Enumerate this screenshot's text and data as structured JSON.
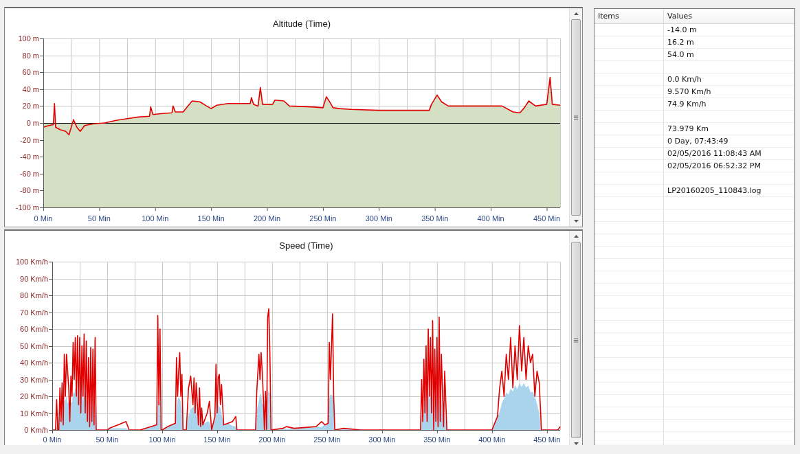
{
  "charts": [
    {
      "chart_data": {
        "type": "area",
        "title": "Altitude (Time)",
        "grid": true,
        "xlim": [
          0,
          462
        ],
        "ylim": [
          -100,
          100
        ],
        "xticks": [
          {
            "value": 0,
            "label": "0 Min"
          },
          {
            "value": 50,
            "label": "50 Min"
          },
          {
            "value": 100,
            "label": "100 Min"
          },
          {
            "value": 150,
            "label": "150 Min"
          },
          {
            "value": 200,
            "label": "200 Min"
          },
          {
            "value": 250,
            "label": "250 Min"
          },
          {
            "value": 300,
            "label": "300 Min"
          },
          {
            "value": 350,
            "label": "350 Min"
          },
          {
            "value": 400,
            "label": "400 Min"
          },
          {
            "value": 450,
            "label": "450 Min"
          }
        ],
        "yticks": [
          {
            "value": 100,
            "label": "100 m"
          },
          {
            "value": 80,
            "label": "80 m"
          },
          {
            "value": 60,
            "label": "60 m"
          },
          {
            "value": 40,
            "label": "40 m"
          },
          {
            "value": 20,
            "label": "20 m"
          },
          {
            "value": 0,
            "label": "0 m"
          },
          {
            "value": -20,
            "label": "-20 m"
          },
          {
            "value": -40,
            "label": "-40 m"
          },
          {
            "value": -60,
            "label": "-60 m"
          },
          {
            "value": -80,
            "label": "-80 m"
          },
          {
            "value": -100,
            "label": "-100 m"
          }
        ],
        "x": [
          0,
          5,
          9,
          10,
          11,
          15,
          20,
          23,
          25,
          27,
          30,
          33,
          37,
          45,
          55,
          65,
          75,
          85,
          95,
          96,
          98,
          105,
          115,
          116,
          118,
          125,
          128,
          133,
          140,
          146,
          150,
          155,
          165,
          185,
          186,
          188,
          192,
          194,
          196,
          205,
          207,
          215,
          220,
          240,
          250,
          253,
          256,
          259,
          265,
          275,
          300,
          330,
          345,
          347,
          352,
          356,
          362,
          375,
          400,
          410,
          420,
          426,
          430,
          434,
          440,
          450,
          453,
          455,
          462
        ],
        "series": [
          {
            "color": "#e00000",
            "values": [
              -5,
              -3,
              -2,
              23,
              -5,
              -8,
              -10,
              -14,
              -5,
              4,
              -5,
              -10,
              -3,
              -1,
              0,
              3,
              5,
              7,
              8,
              19,
              10,
              11,
              12,
              20,
              13,
              13,
              18,
              26,
              25,
              20,
              17,
              21,
              23,
              23,
              30,
              22,
              20,
              42,
              22,
              22,
              27,
              26,
              20,
              19,
              18,
              31,
              25,
              18,
              17,
              16,
              15,
              15,
              15,
              22,
              33,
              25,
              20,
              20,
              20,
              20,
              13,
              12,
              18,
              26,
              20,
              22,
              54,
              22,
              21
            ]
          }
        ]
      }
    },
    {
      "chart_data": {
        "type": "line",
        "title": "Speed (Time)",
        "grid": true,
        "xlim": [
          0,
          462
        ],
        "ylim": [
          0,
          100
        ],
        "xticks": [
          {
            "value": 0,
            "label": "0 Min"
          },
          {
            "value": 50,
            "label": "50 Min"
          },
          {
            "value": 100,
            "label": "100 Min"
          },
          {
            "value": 150,
            "label": "150 Min"
          },
          {
            "value": 200,
            "label": "200 Min"
          },
          {
            "value": 250,
            "label": "250 Min"
          },
          {
            "value": 300,
            "label": "300 Min"
          },
          {
            "value": 350,
            "label": "350 Min"
          },
          {
            "value": 400,
            "label": "400 Min"
          },
          {
            "value": 450,
            "label": "450 Min"
          }
        ],
        "yticks": [
          {
            "value": 100,
            "label": "100 Km/h"
          },
          {
            "value": 90,
            "label": "90 Km/h"
          },
          {
            "value": 80,
            "label": "80 Km/h"
          },
          {
            "value": 70,
            "label": "70 Km/h"
          },
          {
            "value": 60,
            "label": "60 Km/h"
          },
          {
            "value": 50,
            "label": "50 Km/h"
          },
          {
            "value": 40,
            "label": "40 Km/h"
          },
          {
            "value": 30,
            "label": "30 Km/h"
          },
          {
            "value": 20,
            "label": "20 Km/h"
          },
          {
            "value": 10,
            "label": "10 Km/h"
          },
          {
            "value": 0,
            "label": "0 Km/h"
          }
        ],
        "x": [
          0,
          3,
          4,
          5,
          6,
          7,
          8,
          9,
          10,
          11,
          12,
          13,
          14,
          15,
          16,
          17,
          18,
          19,
          20,
          21,
          22,
          23,
          24,
          25,
          26,
          27,
          28,
          29,
          30,
          31,
          32,
          33,
          34,
          35,
          36,
          37,
          38,
          39,
          40,
          50,
          52,
          60,
          67,
          70,
          80,
          85,
          90,
          95,
          96,
          97,
          98,
          99,
          100,
          105,
          112,
          113,
          114,
          115,
          116,
          117,
          118,
          119,
          122,
          124,
          126,
          128,
          129,
          130,
          131,
          133,
          134,
          135,
          136,
          137,
          141,
          143,
          145,
          148,
          149,
          150,
          151,
          152,
          153,
          154,
          156,
          160,
          164,
          167,
          168,
          185,
          186,
          188,
          189,
          190,
          191,
          192,
          193,
          194,
          195,
          196,
          197,
          198,
          199,
          210,
          213,
          220,
          240,
          245,
          248,
          251,
          252,
          253,
          255,
          256,
          257,
          265,
          280,
          335,
          336,
          337,
          338,
          339,
          340,
          341,
          342,
          343,
          344,
          345,
          346,
          347,
          348,
          349,
          350,
          351,
          352,
          353,
          354,
          356,
          357,
          359,
          400,
          405,
          407,
          409,
          411,
          413,
          415,
          417,
          419,
          421,
          423,
          425,
          427,
          429,
          431,
          433,
          435,
          437,
          439,
          441,
          443,
          445,
          460,
          462
        ],
        "series": [
          {
            "color": "#e00000",
            "values": [
              0,
              0,
              18,
              0,
              0,
              25,
              5,
              28,
              3,
              45,
              20,
              45,
              35,
              25,
              5,
              32,
              20,
              52,
              30,
              55,
              20,
              56,
              15,
              55,
              10,
              50,
              20,
              57,
              10,
              53,
              5,
              43,
              2,
              49,
              5,
              48,
              3,
              55,
              0,
              0,
              1,
              3,
              5,
              0,
              0,
              1,
              2,
              3,
              68,
              15,
              60,
              0,
              0,
              2,
              4,
              43,
              20,
              35,
              46,
              20,
              33,
              0,
              0,
              25,
              32,
              15,
              31,
              10,
              28,
              3,
              25,
              2,
              13,
              3,
              10,
              17,
              0,
              8,
              39,
              10,
              31,
              33,
              15,
              27,
              3,
              4,
              5,
              8,
              0,
              0,
              22,
              45,
              30,
              46,
              35,
              20,
              0,
              23,
              0,
              67,
              72,
              45,
              0,
              1,
              2,
              1,
              2,
              5,
              3,
              4,
              52,
              30,
              69,
              20,
              0,
              1,
              0,
              0,
              30,
              5,
              42,
              10,
              50,
              5,
              60,
              20,
              55,
              10,
              65,
              0,
              48,
              5,
              55,
              2,
              67,
              5,
              45,
              2,
              35,
              0,
              0,
              8,
              25,
              35,
              20,
              45,
              30,
              55,
              25,
              50,
              30,
              62,
              35,
              55,
              30,
              50,
              40,
              45,
              20,
              35,
              28,
              0,
              0,
              2
            ]
          }
        ]
      }
    }
  ],
  "table": {
    "columns": [
      "Items",
      "Values"
    ],
    "rows": [
      {
        "kind": "value",
        "value": "-14.0 m"
      },
      {
        "kind": "value",
        "value": "16.2 m"
      },
      {
        "kind": "value",
        "value": "54.0 m"
      },
      {
        "kind": "spacer"
      },
      {
        "kind": "value",
        "value": "0.0 Km/h"
      },
      {
        "kind": "value",
        "value": "9.570 Km/h"
      },
      {
        "kind": "value",
        "value": "74.9 Km/h"
      },
      {
        "kind": "spacer"
      },
      {
        "kind": "value",
        "value": "73.979 Km"
      },
      {
        "kind": "value",
        "value": "0 Day, 07:43:49"
      },
      {
        "kind": "value",
        "value": "02/05/2016 11:08:43 AM"
      },
      {
        "kind": "value",
        "value": "02/05/2016 06:52:32 PM"
      },
      {
        "kind": "spacer"
      },
      {
        "kind": "value",
        "value": "LP20160205_110843.log"
      }
    ]
  }
}
